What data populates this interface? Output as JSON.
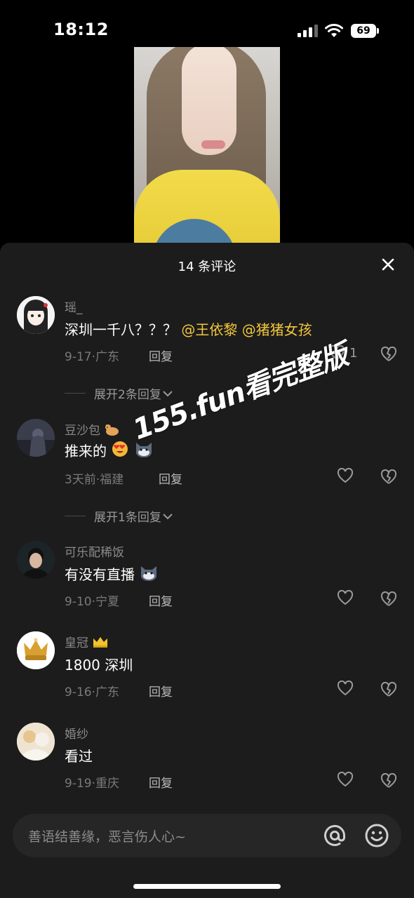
{
  "status": {
    "time": "18:12",
    "battery": "69"
  },
  "sheet": {
    "title": "14 条评论"
  },
  "comments": [
    {
      "user": "瑶_",
      "text_main": "深圳一千八？？？",
      "mentions": [
        "@王依黎",
        "@猪猪女孩"
      ],
      "date": "9-17",
      "location": "广东",
      "reply": "回复",
      "likes": "1",
      "expand": "展开2条回复"
    },
    {
      "user": "豆沙包",
      "user_emoji": "cat-emoji",
      "text_main": "推来的",
      "text_emojis": [
        "heart-eyes-emoji",
        "cat-emoji"
      ],
      "date": "3天前",
      "location": "福建",
      "reply": "回复",
      "expand": "展开1条回复"
    },
    {
      "user": "可乐配稀饭",
      "text_main": "有没有直播",
      "text_emojis": [
        "cat-emoji"
      ],
      "date": "9-10",
      "location": "宁夏",
      "reply": "回复"
    },
    {
      "user": "皇冠",
      "user_emoji": "crown-emoji",
      "text_main": "1800 深圳",
      "date": "9-16",
      "location": "广东",
      "reply": "回复"
    },
    {
      "user": "婚纱",
      "text_main": "看过",
      "date": "9-19",
      "location": "重庆",
      "reply": "回复"
    }
  ],
  "meta_sep": "·",
  "watermark": "155.fun看完整版",
  "input": {
    "placeholder": "善语结善缘，恶言伤人心~"
  },
  "colors": {
    "mention": "#f1c63c",
    "sheet_bg": "#1c1c1c",
    "input_bg": "#262626"
  }
}
